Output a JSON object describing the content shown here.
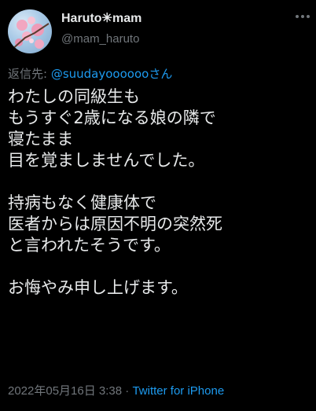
{
  "author": {
    "display_name": "Haruto✳mam",
    "handle": "@mam_haruto"
  },
  "reply": {
    "prefix": "返信先: ",
    "mention": "@suudayoooooo",
    "suffix": "さん"
  },
  "tweet": {
    "paragraphs": [
      {
        "lines": [
          "わたしの同級生も",
          "もうすぐ2歳になる娘の隣で",
          "寝たまま",
          "目を覚ましませんでした。"
        ]
      },
      {
        "lines": [
          "持病もなく健康体で",
          "医者からは原因不明の突然死",
          "と言われたそうです。"
        ]
      },
      {
        "lines": [
          "お悔やみ申し上げます。"
        ]
      }
    ]
  },
  "meta": {
    "timestamp": "2022年05月16日 3:38",
    "separator": " · ",
    "source": "Twitter for iPhone"
  },
  "colors": {
    "background": "#000000",
    "text": "#e7e9ea",
    "secondary": "#71767b",
    "accent": "#1d9bf0"
  }
}
